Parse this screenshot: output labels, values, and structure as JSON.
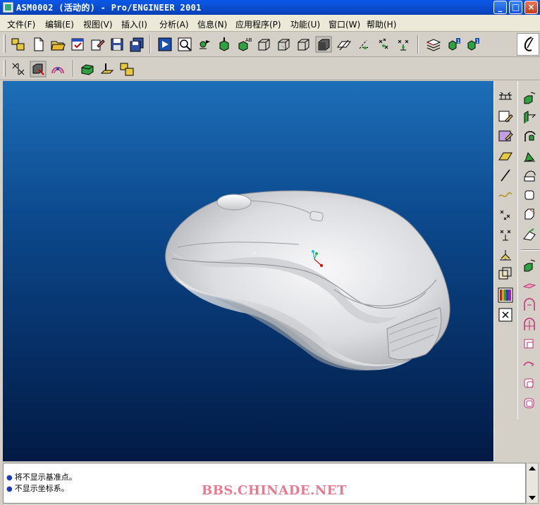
{
  "window": {
    "title": "ASM0002 (活动的) - Pro/ENGINEER 2001",
    "controls": {
      "minimize": "_",
      "maximize": "□",
      "close": "×"
    }
  },
  "menubar": {
    "items": [
      {
        "label": "文件(F)"
      },
      {
        "label": "编辑(E)"
      },
      {
        "label": "视图(V)"
      },
      {
        "label": "插入(I)"
      },
      {
        "label": "分析(A)"
      },
      {
        "label": "信息(N)"
      },
      {
        "label": "应用程序(P)"
      },
      {
        "label": "功能(U)"
      },
      {
        "label": "窗口(W)"
      },
      {
        "label": "帮助(H)"
      }
    ]
  },
  "toolbar_top": {
    "icons": [
      "open-assembly-icon",
      "new-file-icon",
      "open-file-icon",
      "select-window-icon",
      "erase-icon",
      "save-icon",
      "save-copy-icon",
      "repaint-icon",
      "zoom-icon",
      "spin-center-icon",
      "orient-icon",
      "saved-views-icon",
      "wireframe-icon",
      "hidden-line-icon",
      "no-hidden-icon",
      "shaded-icon",
      "datum-planes-icon",
      "datum-axes-icon",
      "datum-points-icon",
      "coord-sys-icon",
      "layers-icon",
      "model-tree-icon",
      "model-info-icon"
    ]
  },
  "toolbar_second": {
    "icons": [
      "assembly-mode-icon",
      "component-select-icon",
      "render-icon",
      "placement-icon",
      "datum-display-icon",
      "package-icon"
    ]
  },
  "right_toolbar_1": {
    "icons": [
      "datum-plane-tool-icon",
      "sketched-curve-icon",
      "sketch-datum-icon",
      "datum-plane-icon",
      "datum-axis-icon",
      "datum-curve-icon",
      "datum-point-icon",
      "offset-point-icon",
      "coord-sys-tool-icon",
      "analysis-feature-icon",
      "color-icon",
      "delete-icon"
    ]
  },
  "right_toolbar_2": {
    "icons": [
      "extrude-icon",
      "revolve-icon",
      "sweep-icon",
      "blend-icon",
      "shell-icon",
      "round-icon",
      "chamfer-icon",
      "draft-icon",
      "hole-icon",
      "rib-icon",
      "cut-icon",
      "protrusion-icon",
      "patch-icon",
      "merge-icon",
      "surface-icon"
    ]
  },
  "messages": [
    {
      "text": "将不显示基准点。"
    },
    {
      "text": "不显示坐标系。"
    }
  ],
  "watermark": "BBS.CHINADE.NET",
  "colors": {
    "viewport_top": "#1d6eb8",
    "viewport_bottom": "#021a44",
    "titlebar": "#0b4fd6",
    "model": "#e8e8ea"
  }
}
